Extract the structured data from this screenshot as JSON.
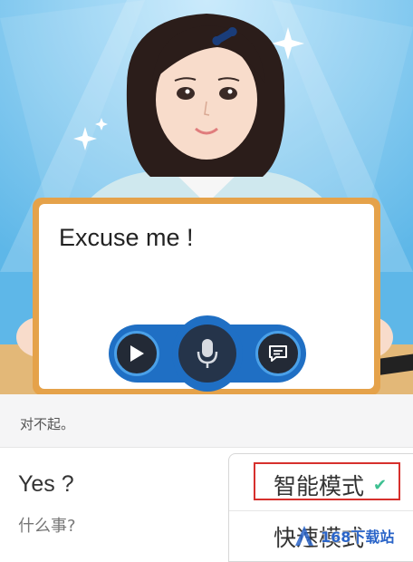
{
  "board": {
    "text": "Excuse me !"
  },
  "controls": {
    "play_icon": "play-icon",
    "mic_icon": "microphone-icon",
    "chat_icon": "chat-bubble-icon"
  },
  "caption": {
    "text": "对不起。"
  },
  "reply": {
    "english": "Yes ?",
    "chinese": "什么事?"
  },
  "mode_menu": {
    "options": [
      {
        "label": "智能模式",
        "selected": true
      },
      {
        "label": "快速模式",
        "selected": false
      }
    ]
  },
  "watermark": {
    "text": "168下载站"
  },
  "colors": {
    "sky": "#6fc3ee",
    "board_frame": "#e5a24a",
    "control_blue": "#1f6fc4",
    "check": "#3ec091",
    "highlight": "#d6302d"
  }
}
